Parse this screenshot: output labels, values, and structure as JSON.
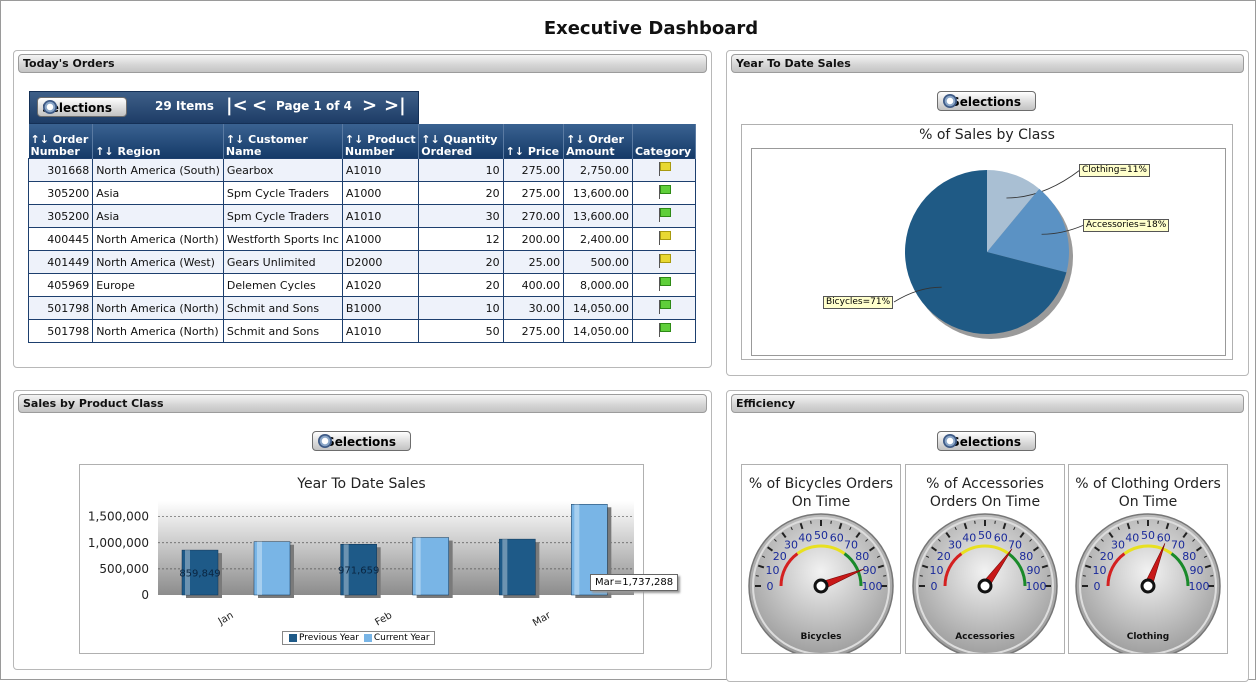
{
  "page": {
    "title": "Executive Dashboard"
  },
  "panels": {
    "orders": {
      "title": "Today's Orders"
    },
    "ytd": {
      "title": "Year To Date Sales"
    },
    "sales_by_class": {
      "title": "Sales by Product Class"
    },
    "efficiency": {
      "title": "Efficiency"
    }
  },
  "pager": {
    "selections": "Selections",
    "items": "29 Items",
    "page": "Page 1 of 4",
    "first": "|<",
    "prev": "<",
    "next": ">",
    "last": ">|"
  },
  "orders_table": {
    "headers": [
      "Order Number",
      "Region",
      "Customer Name",
      "Product Number",
      "Quantity Ordered",
      "Price",
      "Order Amount",
      "Category"
    ],
    "rows": [
      {
        "order": "301668",
        "region": "North America (South)",
        "customer": "Gearbox",
        "product": "A1010",
        "qty": "10",
        "price": "275.00",
        "amount": "2,750.00",
        "flag": "yellow"
      },
      {
        "order": "305200",
        "region": "Asia",
        "customer": "Spm Cycle Traders",
        "product": "A1000",
        "qty": "20",
        "price": "275.00",
        "amount": "13,600.00",
        "flag": "green"
      },
      {
        "order": "305200",
        "region": "Asia",
        "customer": "Spm Cycle Traders",
        "product": "A1010",
        "qty": "30",
        "price": "270.00",
        "amount": "13,600.00",
        "flag": "green"
      },
      {
        "order": "400445",
        "region": "North America (North)",
        "customer": "Westforth Sports Inc",
        "product": "A1000",
        "qty": "12",
        "price": "200.00",
        "amount": "2,400.00",
        "flag": "yellow"
      },
      {
        "order": "401449",
        "region": "North America (West)",
        "customer": "Gears Unlimited",
        "product": "D2000",
        "qty": "20",
        "price": "25.00",
        "amount": "500.00",
        "flag": "yellow"
      },
      {
        "order": "405969",
        "region": "Europe",
        "customer": "Delemen Cycles",
        "product": "A1020",
        "qty": "20",
        "price": "400.00",
        "amount": "8,000.00",
        "flag": "green"
      },
      {
        "order": "501798",
        "region": "North America (North)",
        "customer": "Schmit and Sons",
        "product": "B1000",
        "qty": "10",
        "price": "30.00",
        "amount": "14,050.00",
        "flag": "green"
      },
      {
        "order": "501798",
        "region": "North America (North)",
        "customer": "Schmit and Sons",
        "product": "A1010",
        "qty": "50",
        "price": "275.00",
        "amount": "14,050.00",
        "flag": "green"
      }
    ]
  },
  "buttons": {
    "selections": "Selections"
  },
  "chart_data": [
    {
      "type": "pie",
      "title": "% of Sales by Class",
      "slices": [
        {
          "name": "Bicycles",
          "value": 71,
          "label": "Bicycles=71%",
          "color": "#1f5a85"
        },
        {
          "name": "Accessories",
          "value": 18,
          "label": "Accessories=18%",
          "color": "#5b92c4"
        },
        {
          "name": "Clothing",
          "value": 11,
          "label": "Clothing=11%",
          "color": "#a9bfd3"
        }
      ]
    },
    {
      "type": "bar",
      "title": "Year To Date Sales",
      "categories": [
        "Jan",
        "Feb",
        "Mar"
      ],
      "series": [
        {
          "name": "Previous Year",
          "values": [
            859849,
            971659,
            1070000
          ],
          "color": "#1e5a88"
        },
        {
          "name": "Current Year",
          "values": [
            1020000,
            1100000,
            1737288
          ],
          "color": "#79b5e6"
        }
      ],
      "data_labels": [
        "859,849",
        "971,659"
      ],
      "tooltip": "Mar=1,737,288",
      "yticks": [
        "1,500,000",
        "1,000,000",
        "500,000",
        "0"
      ],
      "ylim": [
        0,
        1800000
      ]
    }
  ],
  "gauges": [
    {
      "title": "% of Bicycles Orders On Time",
      "caption": "Bicycles",
      "value": 88
    },
    {
      "title": "% of Accessories Orders On Time",
      "caption": "Accessories",
      "value": 70
    },
    {
      "title": "% of Clothing Orders On Time",
      "caption": "Clothing",
      "value": 62
    }
  ],
  "gauge_ticks": [
    "0",
    "10",
    "20",
    "30",
    "40",
    "50",
    "60",
    "70",
    "80",
    "90",
    "100"
  ]
}
